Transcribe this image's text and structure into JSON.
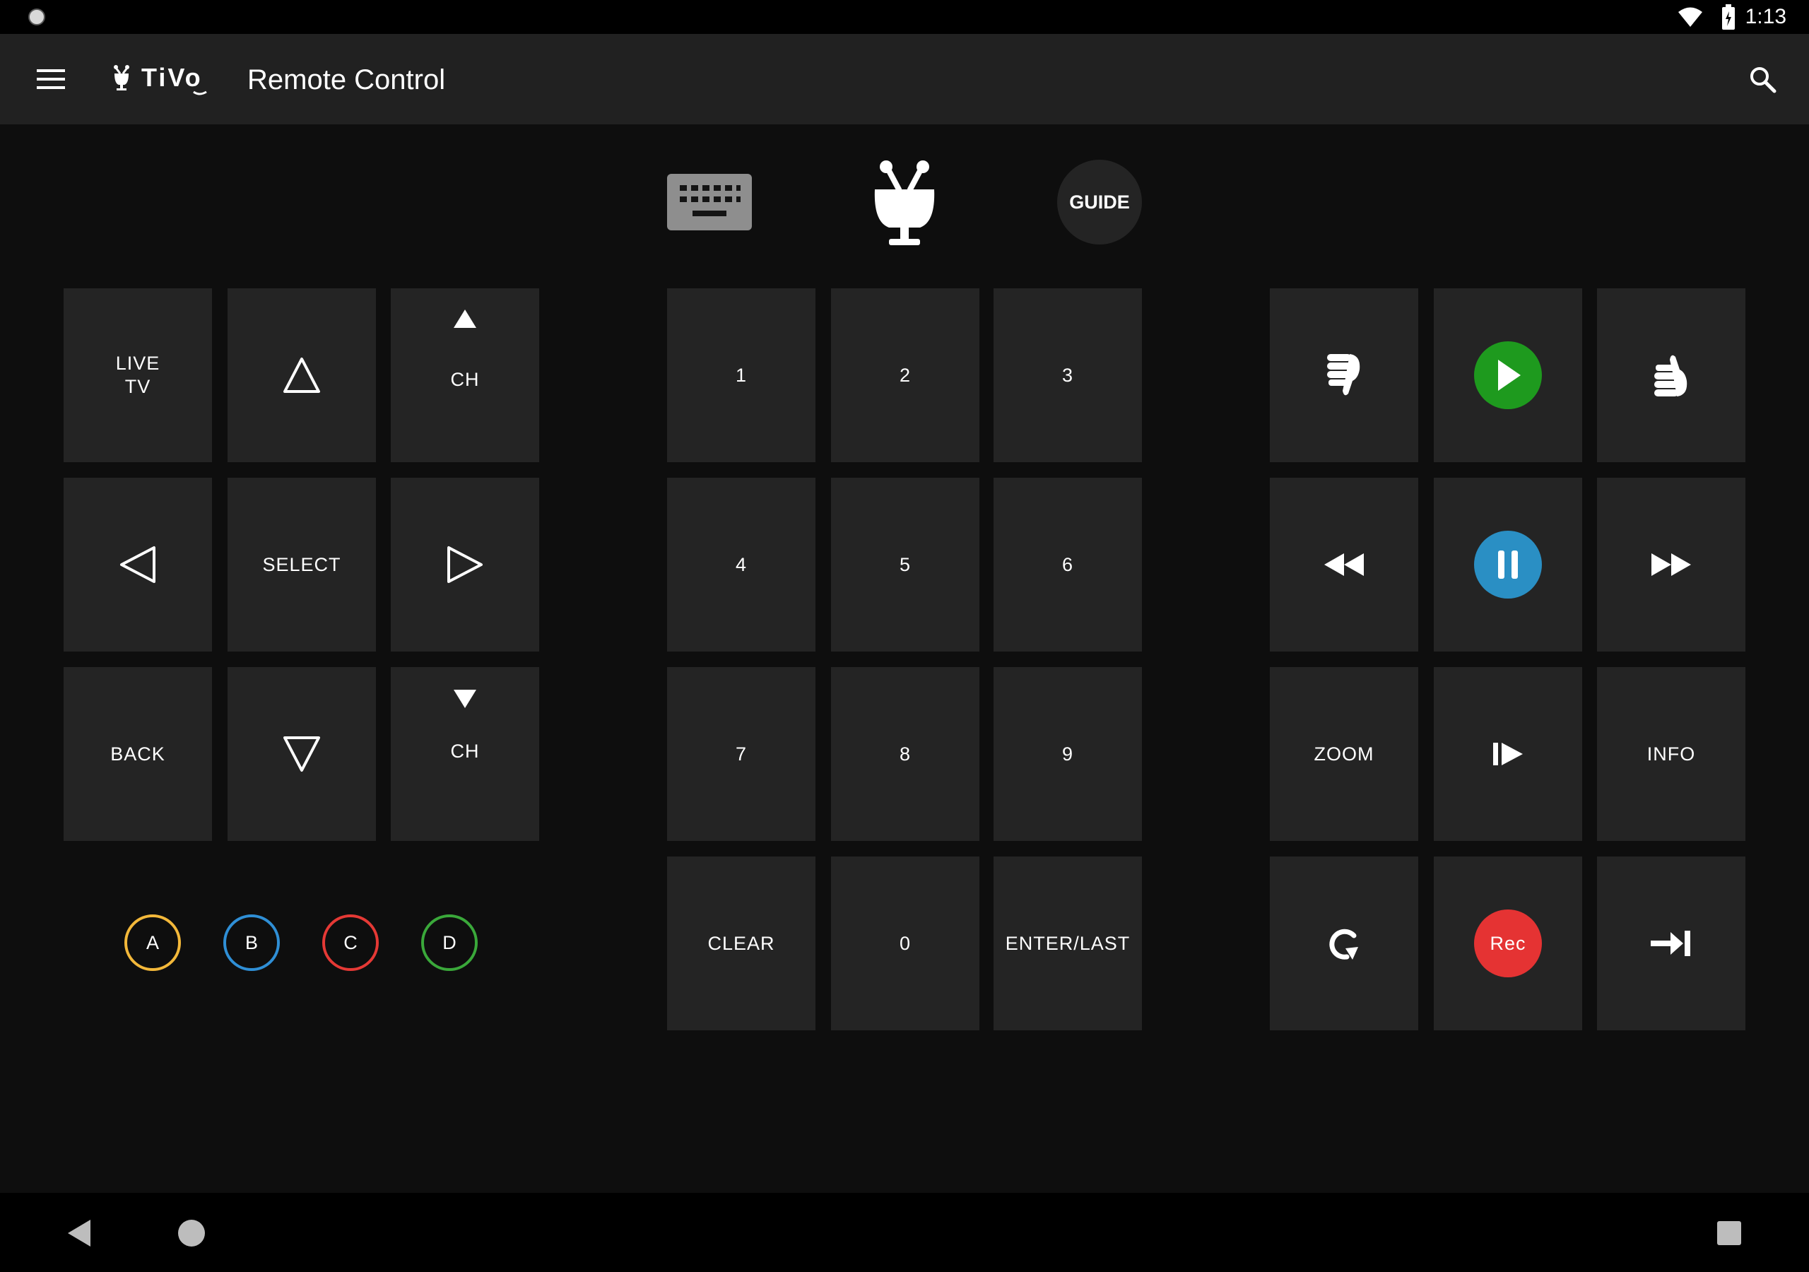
{
  "status_bar": {
    "time": "1:13"
  },
  "app_bar": {
    "logo_text": "TiVo",
    "title": "Remote Control"
  },
  "top": {
    "guide_label": "GUIDE"
  },
  "nav_pad": {
    "live_tv": "LIVE\nTV",
    "select": "SELECT",
    "back": "BACK",
    "ch_up": "CH",
    "ch_down": "CH"
  },
  "numpad": {
    "keys": [
      "1",
      "2",
      "3",
      "4",
      "5",
      "6",
      "7",
      "8",
      "9"
    ],
    "clear": "CLEAR",
    "zero": "0",
    "enter": "ENTER/LAST"
  },
  "transport": {
    "zoom": "ZOOM",
    "info": "INFO",
    "rec": "Rec"
  },
  "color_buttons": [
    {
      "label": "A",
      "color": "#f3b83a"
    },
    {
      "label": "B",
      "color": "#2f8fd6"
    },
    {
      "label": "C",
      "color": "#e53935"
    },
    {
      "label": "D",
      "color": "#3aa83a"
    }
  ],
  "colors": {
    "play": "#1e9a1e",
    "pause": "#2a8fc4",
    "rec": "#e53333",
    "button_bg": "#242424",
    "app_bar": "#212121"
  }
}
